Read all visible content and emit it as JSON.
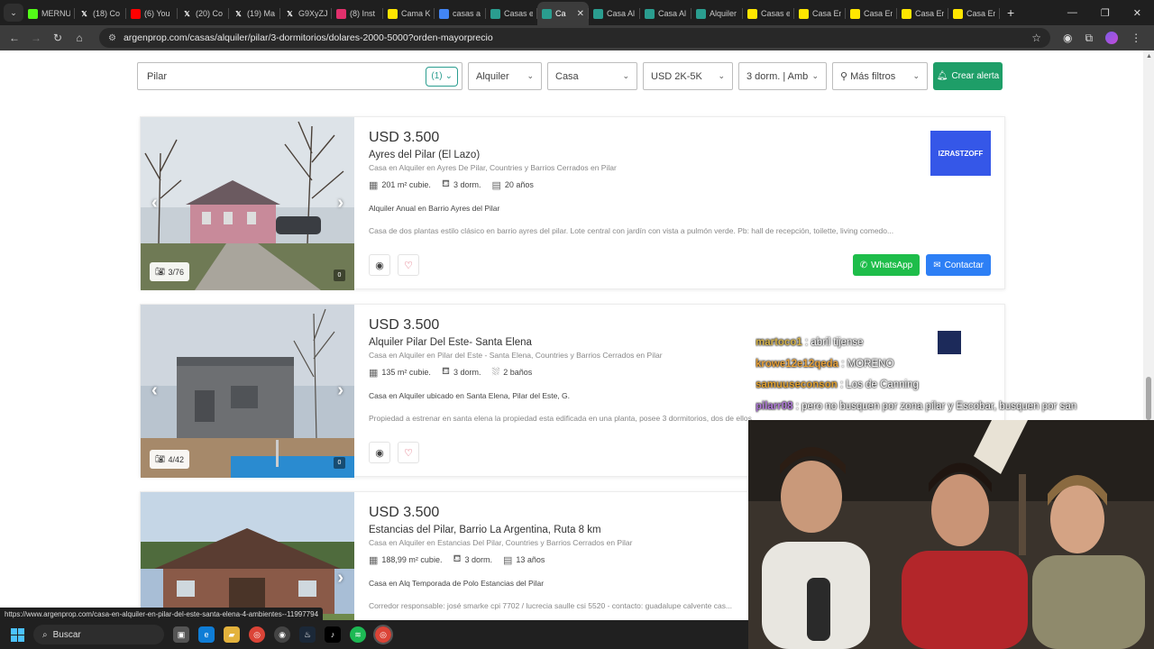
{
  "browser": {
    "tabs": [
      {
        "title": "MERNU",
        "icon": "kick-icon",
        "color": "#53fc18"
      },
      {
        "title": "(18) Co",
        "icon": "x-icon",
        "color": "#ffffff"
      },
      {
        "title": "(6) You",
        "icon": "youtube-icon",
        "color": "#ff0000"
      },
      {
        "title": "(20) Co",
        "icon": "x-icon",
        "color": "#ffffff"
      },
      {
        "title": "(19) Ma",
        "icon": "x-icon",
        "color": "#ffffff"
      },
      {
        "title": "G9XyZJ",
        "icon": "x-icon",
        "color": "#ffffff"
      },
      {
        "title": "(8) Inst",
        "icon": "instagram-icon",
        "color": "#e1306c"
      },
      {
        "title": "Cama K",
        "icon": "mercadolibre-icon",
        "color": "#ffe600"
      },
      {
        "title": "casas a",
        "icon": "google-icon",
        "color": "#4285f4"
      },
      {
        "title": "Casas e",
        "icon": "argenprop-icon",
        "color": "#2a9d8f"
      },
      {
        "title": "Ca",
        "icon": "argenprop-icon",
        "color": "#2a9d8f",
        "active": true
      },
      {
        "title": "Casa Al",
        "icon": "argenprop-icon",
        "color": "#2a9d8f"
      },
      {
        "title": "Casa Al",
        "icon": "argenprop-icon",
        "color": "#2a9d8f"
      },
      {
        "title": "Alquiler",
        "icon": "argenprop-icon",
        "color": "#2a9d8f"
      },
      {
        "title": "Casas e",
        "icon": "mercadolibre-icon",
        "color": "#ffe600"
      },
      {
        "title": "Casa En",
        "icon": "mercadolibre-icon",
        "color": "#ffe600"
      },
      {
        "title": "Casa En",
        "icon": "mercadolibre-icon",
        "color": "#ffe600"
      },
      {
        "title": "Casa En",
        "icon": "mercadolibre-icon",
        "color": "#ffe600"
      },
      {
        "title": "Casa En",
        "icon": "mercadolibre-icon",
        "color": "#ffe600"
      }
    ],
    "url": "argenprop.com/casas/alquiler/pilar/3-dormitorios/dolares-2000-5000?orden-mayorprecio",
    "status_url": "https://www.argenprop.com/casa-en-alquiler-en-pilar-del-este-santa-elena-4-ambientes--11997794"
  },
  "filters": {
    "location": "Pilar",
    "location_count": "(1)",
    "operation": "Alquiler",
    "property_type": "Casa",
    "price": "USD 2K-5K",
    "rooms": "3 dorm. | Amb",
    "more": "Más filtros",
    "alert_button": "Crear alerta"
  },
  "listings": [
    {
      "price": "USD 3.500",
      "title": "Ayres del Pilar (El Lazo)",
      "subtitle": "Casa en Alquiler en Ayres De Pilar, Countries y Barrios Cerrados en Pilar",
      "features": [
        "201 m² cubie.",
        "3 dorm.",
        "20 años"
      ],
      "headline": "Alquiler Anual en Barrio Ayres del Pilar",
      "description": "Casa de dos plantas estilo clásico en barrio ayres del pilar. Lote central con jardín con vista a pulmón verde. Pb: hall de recepción, toilette, living comedo...",
      "photo_counter": "3/76",
      "badge": "0",
      "brand": "IZRASTZOFF",
      "whatsapp": "WhatsApp",
      "contact": "Contactar"
    },
    {
      "price": "USD 3.500",
      "title": "Alquiler Pilar Del Este- Santa Elena",
      "subtitle": "Casa en Alquiler en Pilar del Este - Santa Elena, Countries y Barrios Cerrados en Pilar",
      "features": [
        "135 m² cubie.",
        "3 dorm.",
        "2 baños"
      ],
      "headline": "Casa en Alquiler ubicado en Santa Elena, Pilar del Este, G.",
      "description": "Propiedad a estrenar en santa elena la propiedad esta edificada en una planta, posee 3 dormitorios, dos de ellos...",
      "photo_counter": "4/42",
      "badge": "0"
    },
    {
      "price": "USD 3.500",
      "title": "Estancias del Pilar, Barrio La Argentina, Ruta 8 km",
      "subtitle": "Casa en Alquiler en Estancias Del Pilar, Countries y Barrios Cerrados en Pilar",
      "features": [
        "188,99 m² cubie.",
        "3 dorm.",
        "13 años"
      ],
      "headline": "Casa en Alq Temporada de Polo Estancias del Pilar",
      "description": "Corredor responsable: josé smarke cpi 7702 / lucrecia saulle csi 5520 - contacto: guadalupe calvente cas..."
    }
  ],
  "chat": [
    {
      "user": "martoco1",
      "color": "#d4b24a",
      "message": ": abril tijense"
    },
    {
      "user": "krowe12e12qeda",
      "color": "#e8a23a",
      "message": ": MORENO"
    },
    {
      "user": "samuuseconson",
      "color": "#e0a030",
      "message": ": Los de Canning"
    },
    {
      "user": "pilarr08",
      "color": "#b07ad8",
      "message": ": pero no busquen por zona pilar y Escobar, busquen por san"
    }
  ],
  "taskbar": {
    "search_label": "Buscar"
  }
}
